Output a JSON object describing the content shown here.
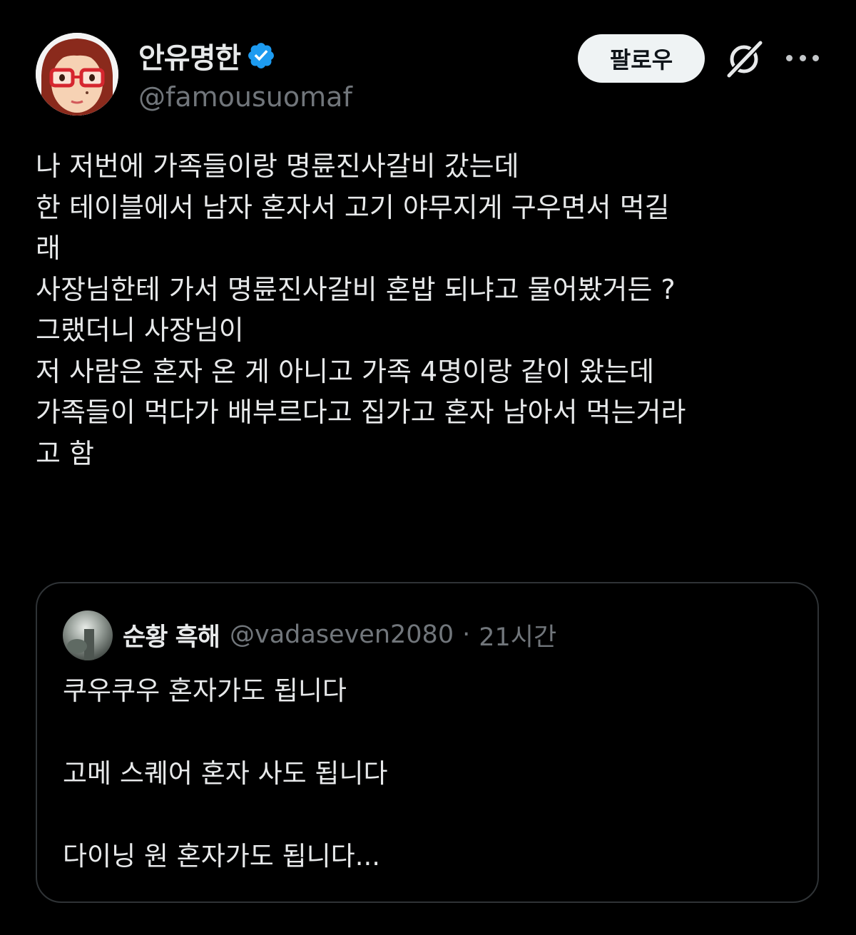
{
  "tweet": {
    "author": {
      "display_name": "안유명한",
      "handle": "@famousuomaf",
      "verified": true,
      "avatar_icon": "mii-avatar-red-glasses"
    },
    "actions": {
      "follow_label": "팔로우",
      "grok_icon": "grok-icon",
      "more_icon": "more-icon"
    },
    "text_lines": [
      "나 저번에 가족들이랑 명륜진사갈비 갔는데",
      "한 테이블에서 남자 혼자서 고기 야무지게 구우면서 먹길",
      "래",
      "사장님한테 가서 명륜진사갈비 혼밥 되냐고 물어봤거든 ?",
      "그랬더니 사장님이",
      "저 사람은 혼자 온 게 아니고 가족 4명이랑 같이 왔는데",
      "가족들이 먹다가 배부르다고 집가고 혼자 남아서 먹는거라",
      "고 함"
    ]
  },
  "quoted_tweet": {
    "author": {
      "display_name": "순황 흑해",
      "handle": "@vadaseven2080",
      "separator": "·",
      "time": "21시간"
    },
    "text_lines": [
      "쿠우쿠우 혼자가도 됩니다",
      "",
      "고메 스퀘어 혼자 사도 됩니다",
      "",
      "다이닝 원 혼자가도 됩니다..."
    ]
  },
  "colors": {
    "background": "#000000",
    "text_primary": "#e7e9ea",
    "text_secondary": "#71767b",
    "verified_blue": "#1d9bf0",
    "border": "#2f3336",
    "follow_bg": "#eff3f4"
  }
}
